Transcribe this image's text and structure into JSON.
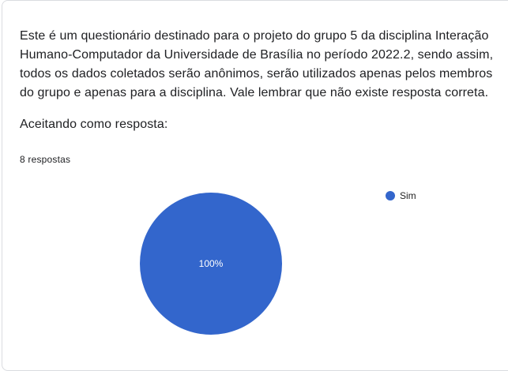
{
  "question": {
    "text": "Este é um questionário destinado para o projeto do grupo 5 da disciplina Interação\nHumano-Computador da Universidade de Brasília no período 2022.2, sendo assim,\ntodos os dados coletados serão anônimos, serão utilizados apenas pelos membros\ndo grupo e apenas para a disciplina. Vale lembrar que não existe resposta correta.",
    "subtext": "Aceitando como resposta:",
    "response_count": "8 respostas"
  },
  "colors": {
    "slice": "#3366cc",
    "label": "#ffffff"
  },
  "chart_data": {
    "type": "pie",
    "categories": [
      "Sim"
    ],
    "values": [
      8
    ],
    "percent_labels": [
      "100%"
    ],
    "legend": [
      "Sim"
    ],
    "legend_position": "right"
  }
}
